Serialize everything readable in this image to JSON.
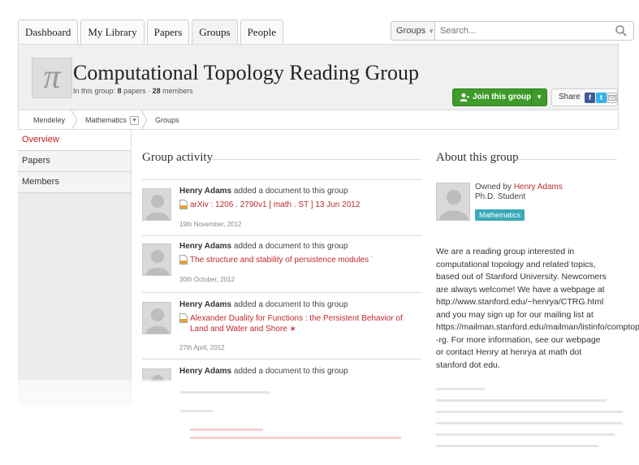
{
  "nav": {
    "tabs": [
      {
        "label": "Dashboard"
      },
      {
        "label": "My Library"
      },
      {
        "label": "Papers"
      },
      {
        "label": "Groups"
      },
      {
        "label": "People"
      }
    ],
    "search_scope": "Groups",
    "search_placeholder": "Search..."
  },
  "group": {
    "title": "Computational Topology Reading Group",
    "icon_glyph": "π",
    "meta_prefix": "In this group:",
    "papers": "8",
    "papers_label": "papers",
    "meta_sep": "·",
    "members": "28",
    "members_label": "members",
    "join_label": "Join this group",
    "share_label": "Share"
  },
  "breadcrumb": {
    "items": [
      "Mendeley",
      "Mathematics",
      "Groups"
    ]
  },
  "sidebar": {
    "items": [
      {
        "label": "Overview"
      },
      {
        "label": "Papers"
      },
      {
        "label": "Members"
      }
    ]
  },
  "activity": {
    "heading": "Group activity",
    "items": [
      {
        "who": "Henry Adams",
        "action": "added a document to this group",
        "doc": "arXiv : 1206 . 2790v1 [ math . ST ] 13 Jun 2012",
        "date": "19th November, 2012"
      },
      {
        "who": "Henry Adams",
        "action": "added a document to this group",
        "doc": "The structure and stability of persistence modules ˙",
        "date": "30th October, 2012"
      },
      {
        "who": "Henry Adams",
        "action": "added a document to this group",
        "doc": "Alexander Duality for Functions : the Persistent Behavior of Land and Water and Shore ∗",
        "date": "27th April, 2012"
      },
      {
        "who": "Henry Adams",
        "action": "added a document to this group"
      }
    ]
  },
  "about": {
    "heading": "About this group",
    "owned_by_label": "Owned by",
    "owner_name": "Henry Adams",
    "owner_role": "Ph.D. Student",
    "tag": "Mathematics",
    "description_lines": [
      "We are a reading group interested in",
      "computational topology and related topics,",
      "based out of Stanford University. Newcomers",
      "are always welcome! We have a webpage at",
      "http://www.stanford.edu/~henrya/CTRG.html",
      "and you may sign up for our mailing list at",
      "https://mailman.stanford.edu/mailman/listinfo/comptop",
      "-rg. For more information, see our webpage",
      "or contact Henry at henrya at math dot",
      "stanford dot edu."
    ]
  },
  "colors": {
    "accent_red": "#c0292b",
    "join_green": "#3f9b2a",
    "tag_teal": "#3aa9b8"
  }
}
